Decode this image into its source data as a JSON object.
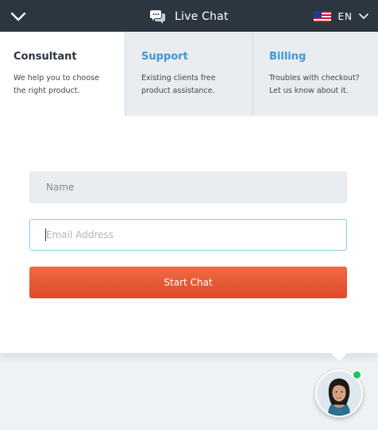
{
  "header": {
    "title": "Live Chat",
    "language": "EN",
    "background_color": "#2b3640"
  },
  "tabs": [
    {
      "title": "Consultant",
      "description_lines": [
        "We help you to choose",
        "the right product."
      ],
      "active": true
    },
    {
      "title": "Support",
      "description_lines": [
        "Existing clients free",
        "product assistance."
      ],
      "active": false
    },
    {
      "title": "Billing",
      "description_lines": [
        "Troubles with checkout?",
        "Let us know about it."
      ],
      "active": false
    }
  ],
  "form": {
    "name_placeholder": "Name",
    "email_placeholder": "Email Address",
    "start_button_label": "Start Chat"
  },
  "colors": {
    "accent_blue": "#3a98d8",
    "button_orange": "#e8532f",
    "online_green": "#22c35e"
  },
  "icons": {
    "collapse": "chevron-down-icon",
    "chat": "chat-bubbles-icon",
    "flag": "us-flag-icon",
    "language_dropdown": "chevron-down-icon"
  }
}
